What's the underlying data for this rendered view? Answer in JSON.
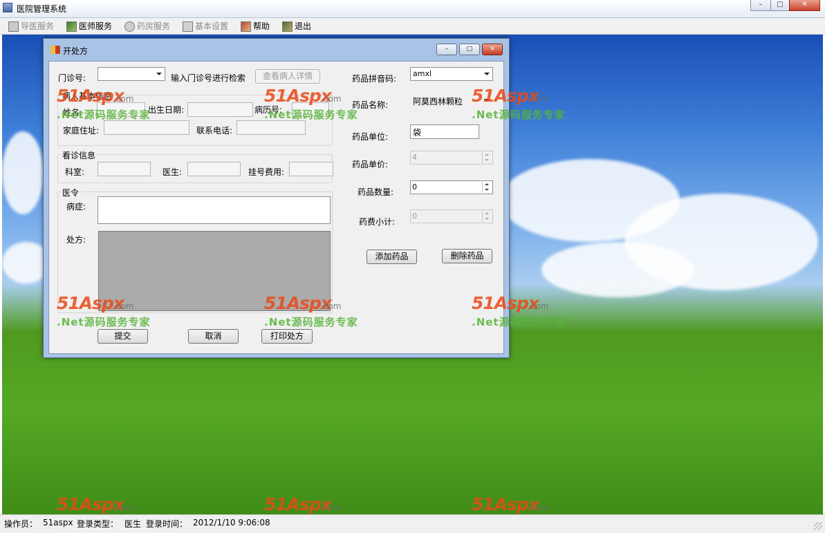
{
  "app": {
    "title": "医院管理系统"
  },
  "menu": [
    {
      "label": "导医服务",
      "enabled": false,
      "icon": "guide-icon"
    },
    {
      "label": "医师服务",
      "enabled": true,
      "icon": "doctor-icon"
    },
    {
      "label": "药房服务",
      "enabled": false,
      "icon": "pharmacy-icon"
    },
    {
      "label": "基本设置",
      "enabled": false,
      "icon": "settings-icon"
    },
    {
      "label": "帮助",
      "enabled": true,
      "icon": "help-icon"
    },
    {
      "label": "退出",
      "enabled": true,
      "icon": "exit-icon"
    }
  ],
  "dialog": {
    "title": "开处方",
    "clinic_no": {
      "label": "门诊号:",
      "value": "",
      "hint": "输入门诊号进行检索"
    },
    "view_patient_button": "查看病人详情",
    "patient_group": {
      "title": "病人基本信息",
      "name_label": "姓名:",
      "name": "",
      "birth_label": "出生日期:",
      "birth": "",
      "record_label": "病历号:",
      "record": "",
      "address_label": "家庭住址:",
      "address": "",
      "phone_label": "联系电话:",
      "phone": ""
    },
    "visit_group": {
      "title": "看诊信息",
      "dept_label": "科室:",
      "dept": "",
      "doctor_label": "医生:",
      "doctor": "",
      "fee_label": "挂号费用:",
      "fee": ""
    },
    "order_group": {
      "title": "医令",
      "symptom_label": "病症:",
      "symptom": "",
      "prescription_label": "处方:"
    },
    "drug": {
      "pinyin_label": "药品拼音码:",
      "pinyin": "amxl",
      "name_label": "药品名称:",
      "name": "阿莫西林颗粒",
      "unit_label": "药品单位:",
      "unit": "袋",
      "price_label": "药品单价:",
      "price": "4",
      "qty_label": "药品数量:",
      "qty": "0",
      "subtotal_label": "药费小计:",
      "subtotal": "0"
    },
    "add_button": "添加药品",
    "delete_button": "删除药品",
    "submit_button": "提交",
    "cancel_button": "取消",
    "print_button": "打印处方"
  },
  "statusbar": {
    "operator_label": "操作员：",
    "operator": "51aspx",
    "login_type_label": "登录类型：",
    "login_type": "医生",
    "login_time_label": "登录时间：",
    "login_time": "2012/1/10 9:06:08"
  },
  "watermark": {
    "brand": "51Aspx",
    "domain": ".com",
    "tagline": ".Net源码服务专家"
  },
  "colors": {
    "accent_orange": "#e94a16",
    "accent_green": "#56b436",
    "prescription_bg": "#ababab"
  }
}
